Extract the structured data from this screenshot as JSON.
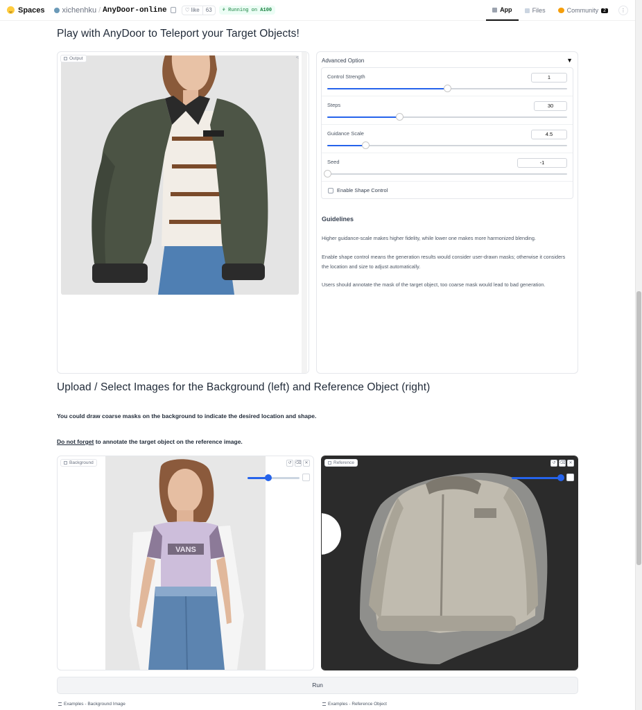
{
  "topbar": {
    "brand": "Spaces",
    "owner": "xichenhku",
    "repo": "AnyDoor-online",
    "like_label": "like",
    "like_count": "63",
    "running_prefix": "Running on ",
    "running_hw": "A100",
    "nav": [
      {
        "label": "App"
      },
      {
        "label": "Files"
      },
      {
        "label": "Community"
      }
    ],
    "community_count": "2"
  },
  "heading1": "Play with AnyDoor to Teleport your Target Objects!",
  "output": {
    "label": "Output"
  },
  "advanced": {
    "header": "Advanced Option",
    "controls": [
      {
        "label": "Control Strength",
        "value": "1",
        "fraction": 0.5
      },
      {
        "label": "Steps",
        "value": "30",
        "fraction": 0.3
      },
      {
        "label": "Guidance Scale",
        "value": "4.5",
        "fraction": 0.16
      },
      {
        "label": "Seed",
        "value": "-1",
        "fraction": 0.0
      }
    ],
    "checkbox_label": "Enable Shape Control"
  },
  "guidelines": {
    "title": "Guidelines",
    "p1": "Higher guidance-scale makes higher fidelity, while lower one makes more harmonized blending.",
    "p2": "Enable shape control means the generation results would consider user-drawn masks; otherwise it considers the location and size to adjust automatically.",
    "p3": "Users should annotate the mask of the target object, too coarse mask would lead to bad generation."
  },
  "heading2": "Upload / Select Images for the Background (left) and Reference Object (right)",
  "instr1": "You could draw coarse masks on the background to indicate the desired location and shape.",
  "instr2_u": "Do not forget",
  "instr2_rest": " to annotate the target object on the reference image.",
  "background": {
    "label": "Background",
    "brush_level": 0.4
  },
  "reference": {
    "label": "Reference",
    "brush_level": 0.95
  },
  "shirt_text": "VANS",
  "run_label": "Run",
  "examples_bg": "Examples - Background Image",
  "examples_ref": "Examples - Reference Object"
}
